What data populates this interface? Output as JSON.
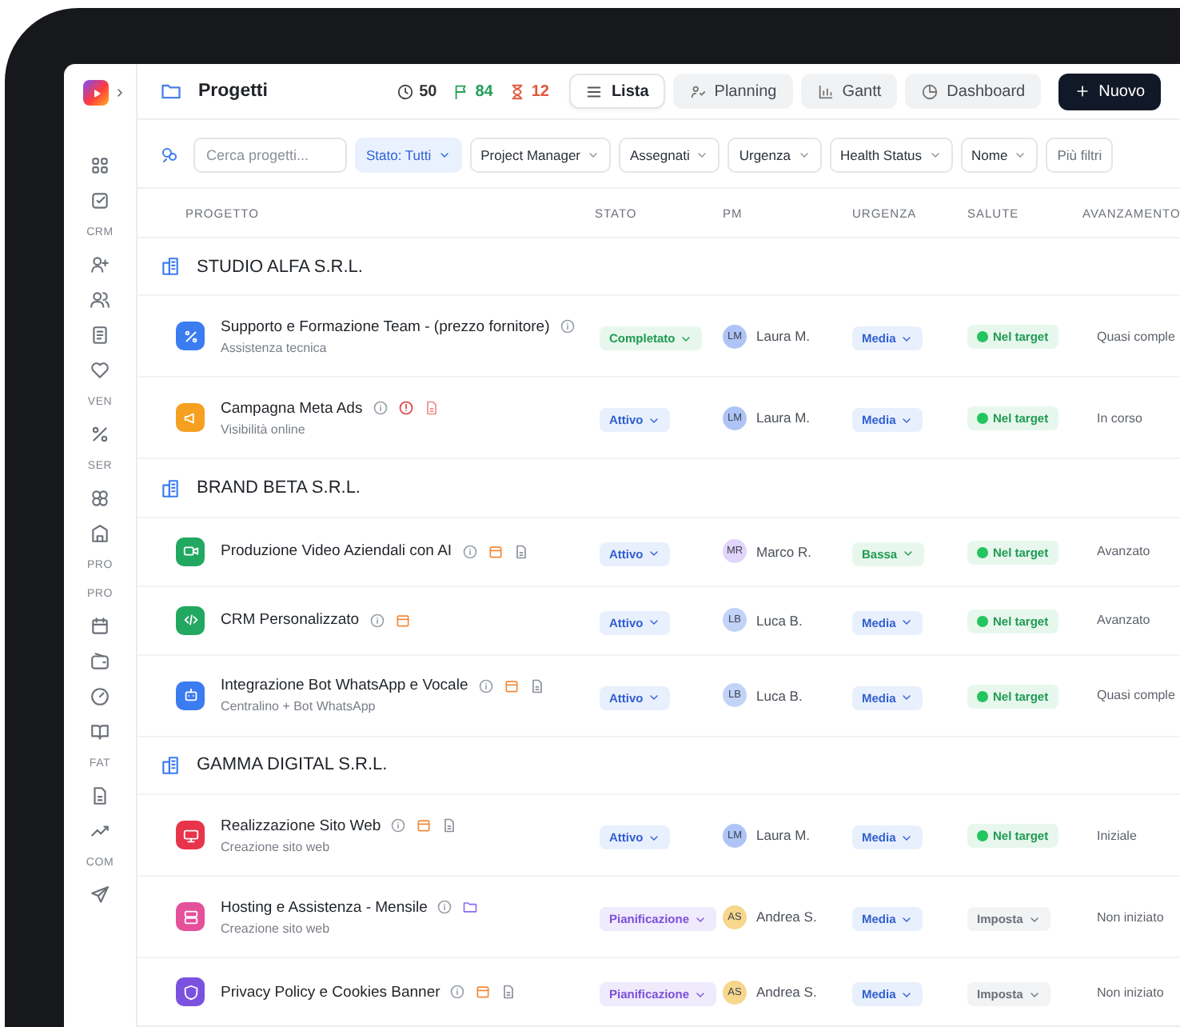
{
  "sidebar": {
    "items": [
      {
        "kind": "nav"
      },
      {
        "kind": "nav"
      },
      {
        "kind": "section",
        "label": "CRM"
      },
      {
        "kind": "nav"
      },
      {
        "kind": "nav"
      },
      {
        "kind": "nav"
      },
      {
        "kind": "nav"
      },
      {
        "kind": "section",
        "label": "VEN"
      },
      {
        "kind": "nav"
      },
      {
        "kind": "section",
        "label": "SER"
      },
      {
        "kind": "nav"
      },
      {
        "kind": "nav"
      },
      {
        "kind": "section",
        "label": "PRO"
      },
      {
        "kind": "section",
        "label": "PRO"
      },
      {
        "kind": "nav"
      },
      {
        "kind": "nav"
      },
      {
        "kind": "nav"
      },
      {
        "kind": "nav"
      },
      {
        "kind": "section",
        "label": "FAT"
      },
      {
        "kind": "nav"
      },
      {
        "kind": "nav"
      },
      {
        "kind": "section",
        "label": "COM"
      },
      {
        "kind": "nav"
      }
    ]
  },
  "header": {
    "title": "Progetti",
    "stats": [
      {
        "kind": "time",
        "value": "50"
      },
      {
        "kind": "flag",
        "value": "84"
      },
      {
        "kind": "pending",
        "value": "12"
      }
    ],
    "views": [
      {
        "label": "Lista",
        "selected": true
      },
      {
        "label": "Planning",
        "selected": false
      },
      {
        "label": "Gantt",
        "selected": false
      },
      {
        "label": "Dashboard",
        "selected": false
      }
    ],
    "new_button": "Nuovo"
  },
  "filters": {
    "search": {
      "placeholder": "Cerca progetti..."
    },
    "dropdowns": [
      {
        "label": "Stato: Tutti",
        "active": true
      },
      {
        "label": "Project Manager",
        "active": false
      },
      {
        "label": "Assegnati",
        "active": false
      },
      {
        "label": "Urgenza",
        "active": false
      },
      {
        "label": "Health Status",
        "active": false
      },
      {
        "label": "Nome",
        "active": false
      }
    ],
    "more": "Più filtri"
  },
  "table": {
    "columns": [
      "PROGETTO",
      "STATO",
      "PM",
      "URGENZA",
      "SALUTE",
      "AVANZAMENTO"
    ],
    "groups": [
      {
        "name": "STUDIO ALFA S.R.L.",
        "rows": [
          {
            "title": "Supporto e Formazione Team - (prezzo fornitore)",
            "subtitle": "Assistenza tecnica",
            "color": "#3b7cf0",
            "indicators": [
              {
                "kind": "info"
              }
            ],
            "status": {
              "label": "Completato",
              "kind": "done"
            },
            "pm": {
              "initials": "LM",
              "name": "Laura M.",
              "color": "#aec4f6"
            },
            "urgency": {
              "label": "Media",
              "kind": "medium"
            },
            "health": {
              "label": "Nel target",
              "kind": "ok"
            },
            "progress": "Quasi comple"
          },
          {
            "title": "Campagna Meta Ads",
            "subtitle": "Visibilità online",
            "color": "#f5a020",
            "indicators": [
              {
                "kind": "info"
              },
              {
                "kind": "alert"
              },
              {
                "kind": "doc_red"
              }
            ],
            "status": {
              "label": "Attivo",
              "kind": "active"
            },
            "pm": {
              "initials": "LM",
              "name": "Laura M.",
              "color": "#aec4f6"
            },
            "urgency": {
              "label": "Media",
              "kind": "medium"
            },
            "health": {
              "label": "Nel target",
              "kind": "ok"
            },
            "progress": "In corso"
          }
        ]
      },
      {
        "name": "BRAND BETA S.R.L.",
        "rows": [
          {
            "title": "Produzione Video Aziendali con AI",
            "color": "#22a861",
            "indicators": [
              {
                "kind": "info"
              },
              {
                "kind": "calendar"
              },
              {
                "kind": "doc"
              }
            ],
            "status": {
              "label": "Attivo",
              "kind": "active"
            },
            "pm": {
              "initials": "MR",
              "name": "Marco R.",
              "color": "#e2d5fb"
            },
            "urgency": {
              "label": "Bassa",
              "kind": "low"
            },
            "health": {
              "label": "Nel target",
              "kind": "ok"
            },
            "progress": "Avanzato"
          },
          {
            "title": "CRM Personalizzato",
            "color": "#22a861",
            "indicators": [
              {
                "kind": "info"
              },
              {
                "kind": "calendar"
              }
            ],
            "status": {
              "label": "Attivo",
              "kind": "active"
            },
            "pm": {
              "initials": "LB",
              "name": "Luca B.",
              "color": "#c1d3f7"
            },
            "urgency": {
              "label": "Media",
              "kind": "medium"
            },
            "health": {
              "label": "Nel target",
              "kind": "ok"
            },
            "progress": "Avanzato"
          },
          {
            "title": "Integrazione Bot WhatsApp e Vocale",
            "subtitle": "Centralino + Bot WhatsApp",
            "color": "#3b7cf0",
            "indicators": [
              {
                "kind": "info"
              },
              {
                "kind": "calendar"
              },
              {
                "kind": "doc"
              }
            ],
            "status": {
              "label": "Attivo",
              "kind": "active"
            },
            "pm": {
              "initials": "LB",
              "name": "Luca B.",
              "color": "#c1d3f7"
            },
            "urgency": {
              "label": "Media",
              "kind": "medium"
            },
            "health": {
              "label": "Nel target",
              "kind": "ok"
            },
            "progress": "Quasi comple"
          }
        ]
      },
      {
        "name": "GAMMA DIGITAL S.R.L.",
        "rows": [
          {
            "title": "Realizzazione Sito Web",
            "subtitle": "Creazione sito web",
            "color": "#e8344a",
            "indicators": [
              {
                "kind": "info"
              },
              {
                "kind": "calendar"
              },
              {
                "kind": "doc"
              }
            ],
            "status": {
              "label": "Attivo",
              "kind": "active"
            },
            "pm": {
              "initials": "LM",
              "name": "Laura M.",
              "color": "#aec4f6"
            },
            "urgency": {
              "label": "Media",
              "kind": "medium"
            },
            "health": {
              "label": "Nel target",
              "kind": "ok"
            },
            "progress": "Iniziale"
          },
          {
            "title": "Hosting e Assistenza - Mensile",
            "subtitle": "Creazione sito web",
            "color": "#e4509a",
            "indicators": [
              {
                "kind": "info"
              },
              {
                "kind": "folder"
              }
            ],
            "status": {
              "label": "Pianificazione",
              "kind": "planning"
            },
            "pm": {
              "initials": "AS",
              "name": "Andrea S.",
              "color": "#f6d78c"
            },
            "urgency": {
              "label": "Media",
              "kind": "medium"
            },
            "health": {
              "label": "Imposta",
              "kind": "unset"
            },
            "progress": "Non iniziato"
          },
          {
            "title": "Privacy Policy e Cookies Banner",
            "color": "#7b52e0",
            "indicators": [
              {
                "kind": "info"
              },
              {
                "kind": "calendar"
              },
              {
                "kind": "doc"
              }
            ],
            "status": {
              "label": "Pianificazione",
              "kind": "planning"
            },
            "pm": {
              "initials": "AS",
              "name": "Andrea S.",
              "color": "#f6d78c"
            },
            "urgency": {
              "label": "Media",
              "kind": "medium"
            },
            "health": {
              "label": "Imposta",
              "kind": "unset"
            },
            "progress": "Non iniziato"
          }
        ]
      }
    ]
  }
}
